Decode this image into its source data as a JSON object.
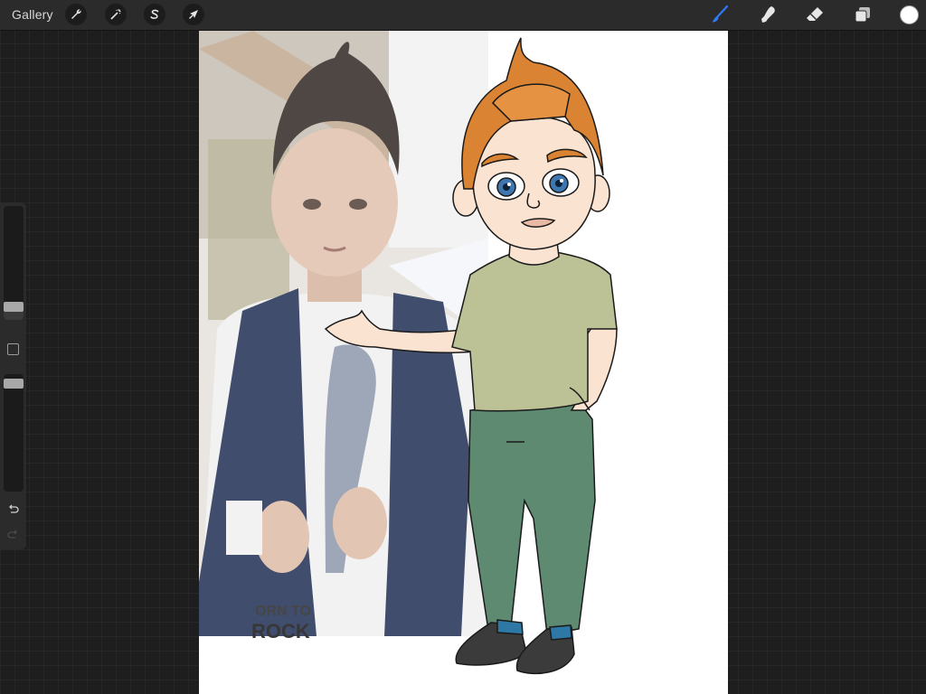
{
  "toolbar": {
    "gallery_label": "Gallery",
    "left_tools": [
      {
        "name": "actions",
        "icon": "wrench-icon"
      },
      {
        "name": "adjustments",
        "icon": "magic-wand-icon"
      },
      {
        "name": "selection",
        "icon": "selection-s-icon"
      },
      {
        "name": "transform",
        "icon": "arrow-cursor-icon"
      }
    ],
    "right_tools": [
      {
        "name": "brush",
        "icon": "brush-icon",
        "active": true
      },
      {
        "name": "smudge",
        "icon": "smudge-finger-icon"
      },
      {
        "name": "eraser",
        "icon": "eraser-icon"
      },
      {
        "name": "layers",
        "icon": "layers-icon"
      }
    ],
    "current_color": "#ffffff",
    "accent_color": "#2d7cf6"
  },
  "sidebar": {
    "brush_size_level": 0.85,
    "opacity_level": 0.95,
    "undo_icon": "undo-icon",
    "redo_icon": "redo-icon"
  },
  "canvas": {
    "photo_text": "ORN TO\nROCK"
  }
}
